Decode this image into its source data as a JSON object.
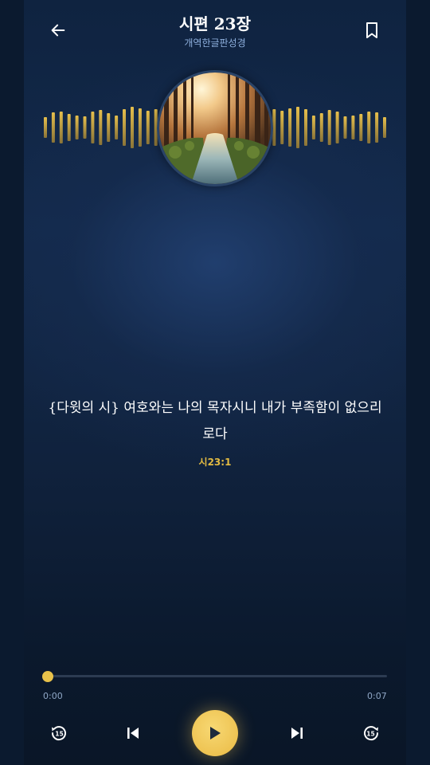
{
  "header": {
    "title": "시편 23장",
    "subtitle": "개역한글판성경",
    "back_icon": "arrow-left-icon",
    "bookmark_icon": "bookmark-icon"
  },
  "artwork": {
    "description_icon": "forest-river-artwork"
  },
  "verse": {
    "text": "{다윗의 시} 여호와는 나의 목자시니 내가 부족함이 없으리로다",
    "reference": "시23:1"
  },
  "player": {
    "current_time": "0:00",
    "total_time": "0:07",
    "progress_fraction": 0.0,
    "rewind_label": "15",
    "forward_label": "15",
    "icons": {
      "rewind": "replay-15-icon",
      "previous": "skip-previous-icon",
      "play": "play-icon",
      "next": "skip-next-icon",
      "forward": "forward-15-icon"
    }
  },
  "colors": {
    "accent": "#e8c14a",
    "subtitle": "#8fb0de",
    "reference": "#e3bb42",
    "background": "#0f2340"
  }
}
